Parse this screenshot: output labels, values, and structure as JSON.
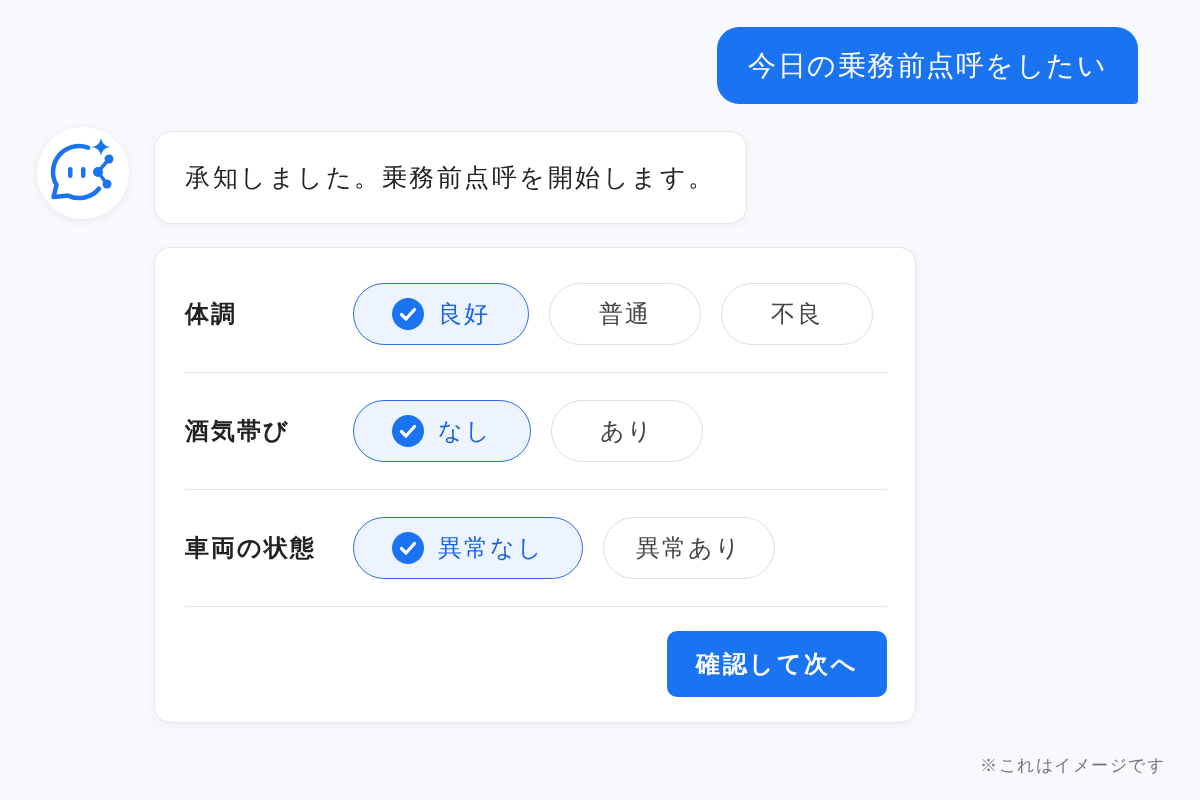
{
  "messages": [
    {
      "kind": "user",
      "text": "今日の乗務前点呼をしたい"
    },
    {
      "kind": "assistant",
      "text": "承知しました。乗務前点呼を開始します。"
    }
  ],
  "form": {
    "rows": [
      {
        "label": "体調",
        "options": [
          {
            "label": "良好",
            "selected": true
          },
          {
            "label": "普通",
            "selected": false
          },
          {
            "label": "不良",
            "selected": false
          }
        ]
      },
      {
        "label": "酒気帯び",
        "options": [
          {
            "label": "なし",
            "selected": true
          },
          {
            "label": "あり",
            "selected": false
          }
        ]
      },
      {
        "label": "車両の状態",
        "options": [
          {
            "label": "異常なし",
            "selected": true
          },
          {
            "label": "異常あり",
            "selected": false
          }
        ]
      }
    ],
    "submit_button": "確認して次へ"
  },
  "footnote": "※これはイメージです"
}
